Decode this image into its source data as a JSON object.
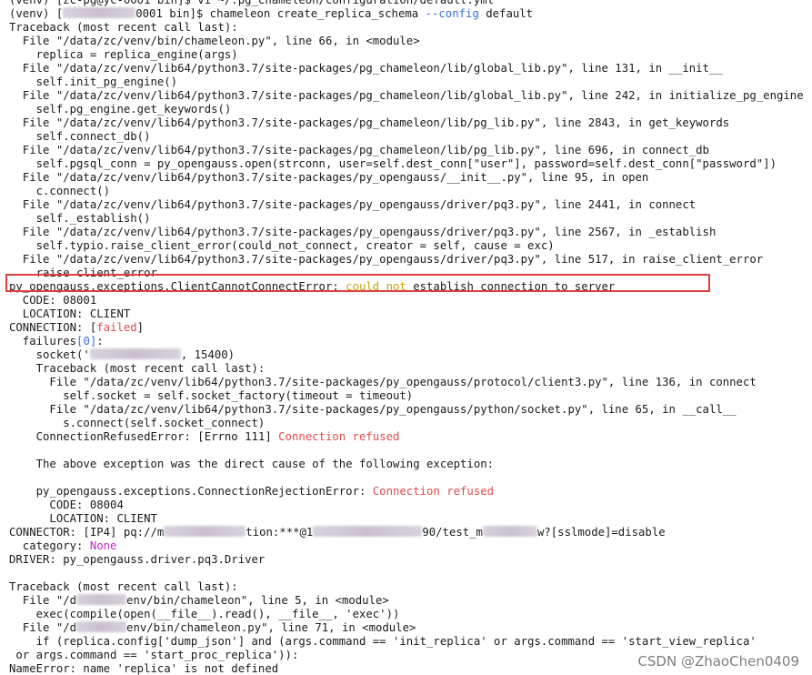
{
  "terminal": {
    "lines": [
      {
        "segs": [
          {
            "t": "(venv) [zc-pg@yc-0001 bin]$ vi ~/.pg_chameleon/configuration/default.yml"
          }
        ]
      },
      {
        "segs": [
          {
            "t": "(venv) ["
          },
          {
            "blur": 80
          },
          {
            "t": "0001 bin]$ chameleon create_replica_schema "
          },
          {
            "t": "--config",
            "c": "blue"
          },
          {
            "t": " default"
          }
        ]
      },
      {
        "segs": [
          {
            "t": "Traceback (most recent call last):"
          }
        ]
      },
      {
        "segs": [
          {
            "t": "  File \"/data/zc/venv/bin/chameleon.py\", line 66, in <module>"
          }
        ]
      },
      {
        "segs": [
          {
            "t": "    replica = replica_engine(args)"
          }
        ]
      },
      {
        "segs": [
          {
            "t": "  File \"/data/zc/venv/lib64/python3.7/site-packages/pg_chameleon/lib/global_lib.py\", line 131, in __init__"
          }
        ]
      },
      {
        "segs": [
          {
            "t": "    self.init_pg_engine()"
          }
        ]
      },
      {
        "segs": [
          {
            "t": "  File \"/data/zc/venv/lib64/python3.7/site-packages/pg_chameleon/lib/global_lib.py\", line 242, in initialize_pg_engine"
          }
        ]
      },
      {
        "segs": [
          {
            "t": "    self.pg_engine.get_keywords()"
          }
        ]
      },
      {
        "segs": [
          {
            "t": "  File \"/data/zc/venv/lib64/python3.7/site-packages/pg_chameleon/lib/pg_lib.py\", line 2843, in get_keywords"
          }
        ]
      },
      {
        "segs": [
          {
            "t": "    self.connect_db()"
          }
        ]
      },
      {
        "segs": [
          {
            "t": "  File \"/data/zc/venv/lib64/python3.7/site-packages/pg_chameleon/lib/pg_lib.py\", line 696, in connect_db"
          }
        ]
      },
      {
        "segs": [
          {
            "t": "    self.pgsql_conn = py_opengauss.open(strconn, user=self.dest_conn[\"user\"], password=self.dest_conn[\"password\"])"
          }
        ]
      },
      {
        "segs": [
          {
            "t": "  File \"/data/zc/venv/lib64/python3.7/site-packages/py_opengauss/__init__.py\", line 95, in open"
          }
        ]
      },
      {
        "segs": [
          {
            "t": "    c.connect()"
          }
        ]
      },
      {
        "segs": [
          {
            "t": "  File \"/data/zc/venv/lib64/python3.7/site-packages/py_opengauss/driver/pq3.py\", line 2441, in connect"
          }
        ]
      },
      {
        "segs": [
          {
            "t": "    self._establish()"
          }
        ]
      },
      {
        "segs": [
          {
            "t": "  File \"/data/zc/venv/lib64/python3.7/site-packages/py_opengauss/driver/pq3.py\", line 2567, in _establish"
          }
        ]
      },
      {
        "segs": [
          {
            "t": "    self.typio.raise_client_error(could_not_connect, creator = self, cause = exc)"
          }
        ]
      },
      {
        "segs": [
          {
            "t": "  File \"/data/zc/venv/lib64/python3.7/site-packages/py_opengauss/driver/pq3.py\", line 517, in raise_client_error"
          }
        ]
      },
      {
        "segs": [
          {
            "t": "    raise client_error"
          }
        ]
      },
      {
        "segs": [
          {
            "t": "py_opengauss.exceptions.ClientCannotConnectError: "
          },
          {
            "t": "could not",
            "c": "yellow"
          },
          {
            "t": " establish connection to server"
          }
        ]
      },
      {
        "segs": [
          {
            "t": "  CODE: 08001"
          }
        ]
      },
      {
        "segs": [
          {
            "t": "  LOCATION: CLIENT"
          }
        ]
      },
      {
        "segs": [
          {
            "t": "CONNECTION: ["
          },
          {
            "t": "failed",
            "c": "red"
          },
          {
            "t": "]"
          }
        ]
      },
      {
        "segs": [
          {
            "t": "  failures"
          },
          {
            "t": "[0]",
            "c": "blue"
          },
          {
            "t": ":"
          }
        ]
      },
      {
        "segs": [
          {
            "t": "    socket('"
          },
          {
            "blur": 100
          },
          {
            "t": ", 15400)"
          }
        ]
      },
      {
        "segs": [
          {
            "t": "    Traceback (most recent call last):"
          }
        ]
      },
      {
        "segs": [
          {
            "t": "      File \"/data/zc/venv/lib64/python3.7/site-packages/py_opengauss/protocol/client3.py\", line 136, in connect"
          }
        ]
      },
      {
        "segs": [
          {
            "t": "        self.socket = self.socket_factory(timeout = timeout)"
          }
        ]
      },
      {
        "segs": [
          {
            "t": "      File \"/data/zc/venv/lib64/python3.7/site-packages/py_opengauss/python/socket.py\", line 65, in __call__"
          }
        ]
      },
      {
        "segs": [
          {
            "t": "        s.connect(self.socket_connect)"
          }
        ]
      },
      {
        "segs": [
          {
            "t": "    ConnectionRefusedError: [Errno 111] "
          },
          {
            "t": "Connection refused",
            "c": "red"
          }
        ]
      },
      {
        "segs": [
          {
            "t": ""
          }
        ]
      },
      {
        "segs": [
          {
            "t": "    The above exception was the direct cause of the following exception:"
          }
        ]
      },
      {
        "segs": [
          {
            "t": ""
          }
        ]
      },
      {
        "segs": [
          {
            "t": "    py_opengauss.exceptions.ConnectionRejectionError: "
          },
          {
            "t": "Connection refused",
            "c": "red"
          }
        ]
      },
      {
        "segs": [
          {
            "t": "      CODE: 08004"
          }
        ]
      },
      {
        "segs": [
          {
            "t": "      LOCATION: CLIENT"
          }
        ]
      },
      {
        "segs": [
          {
            "t": "CONNECTOR: [IP4] pq://m"
          },
          {
            "blur": 90
          },
          {
            "t": "tion:***@1"
          },
          {
            "blur": 120
          },
          {
            "t": "90/test_m"
          },
          {
            "blur": 60
          },
          {
            "t": "w?[sslmode]=disable"
          }
        ]
      },
      {
        "segs": [
          {
            "t": "  category: "
          },
          {
            "t": "None",
            "c": "magenta"
          }
        ]
      },
      {
        "segs": [
          {
            "t": "DRIVER: py_opengauss.driver.pq3.Driver"
          }
        ]
      },
      {
        "segs": [
          {
            "t": ""
          }
        ]
      },
      {
        "segs": [
          {
            "t": "Traceback (most recent call last):"
          }
        ]
      },
      {
        "segs": [
          {
            "t": "  File \"/d"
          },
          {
            "blur": 55
          },
          {
            "t": "env/bin/chameleon\", line 5, in <module>"
          }
        ]
      },
      {
        "segs": [
          {
            "t": "    exec(compile(open(__file__).read(), __file__, 'exec'))"
          }
        ]
      },
      {
        "segs": [
          {
            "t": "  File \"/d"
          },
          {
            "blur": 55
          },
          {
            "t": "env/bin/chameleon.py\", line 71, in <module>"
          }
        ]
      },
      {
        "segs": [
          {
            "t": "    if (replica.config['dump_json'] and (args.command == 'init_replica' or args.command == 'start_view_replica'"
          }
        ]
      },
      {
        "segs": [
          {
            "t": " or args.command == 'start_proc_replica')):"
          }
        ]
      },
      {
        "segs": [
          {
            "t": "NameError: name 'replica' is not defined"
          }
        ]
      }
    ]
  },
  "watermark": "CSDN @ZhaoChen0409",
  "colors": {
    "blue": "#3b6fd6",
    "red": "#e04b4b",
    "yellow": "#c2a30a",
    "magenta": "#c02ac2",
    "highlight_box": "#e23c3c"
  }
}
